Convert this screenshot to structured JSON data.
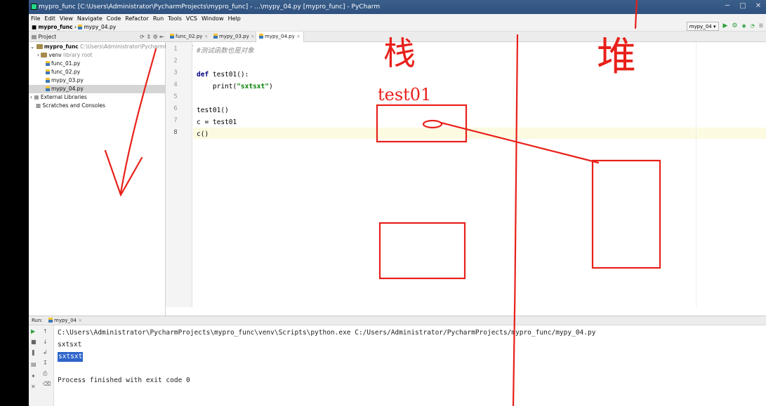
{
  "window": {
    "title": "mypro_func [C:\\Users\\Administrator\\PycharmProjects\\mypro_func] - ...\\mypy_04.py [mypro_func] - PyCharm",
    "controls": [
      "─",
      "□",
      "✕"
    ]
  },
  "menu": [
    "File",
    "Edit",
    "View",
    "Navigate",
    "Code",
    "Refactor",
    "Run",
    "Tools",
    "VCS",
    "Window",
    "Help"
  ],
  "breadcrumb": {
    "project": "mypro_func",
    "file": "mypy_04.py"
  },
  "run_config": {
    "name": "mypy_04"
  },
  "project_panel": {
    "header": "Project",
    "tree": [
      {
        "label": "mypro_func",
        "suffix": "C:\\Users\\Administrator\\PycharmProjects\\mypro_func",
        "type": "folder"
      },
      {
        "label": "venv",
        "suffix": "library root",
        "type": "folder"
      },
      {
        "label": "func_01.py",
        "type": "py"
      },
      {
        "label": "func_02.py",
        "type": "py"
      },
      {
        "label": "mypy_03.py",
        "type": "py"
      },
      {
        "label": "mypy_04.py",
        "type": "py"
      },
      {
        "label": "External Libraries",
        "type": "lib"
      },
      {
        "label": "Scratches and Consoles",
        "type": "scratch"
      }
    ]
  },
  "editor": {
    "tabs": [
      "func_02.py",
      "mypy_03.py",
      "mypy_04.py"
    ],
    "active_tab": 2,
    "line_numbers": [
      "1",
      "2",
      "3",
      "4",
      "5",
      "6",
      "7",
      "8"
    ],
    "code": {
      "l1": "#测试函数也是对象",
      "l3_kw": "def",
      "l3_rest": " test01():",
      "l4_pre": "    print(",
      "l4_str": "\"sxtsxt\"",
      "l4_post": ")",
      "l6": "test01()",
      "l7": "c = test01",
      "l8": "c()"
    }
  },
  "run_panel": {
    "header": "Run:",
    "tab": "mypy_04",
    "output": [
      "C:\\Users\\Administrator\\PycharmProjects\\mypro_func\\venv\\Scripts\\python.exe C:/Users/Administrator/PycharmProjects/mypro_func/mypy_04.py",
      "sxtsxt",
      "sxtsxt",
      "",
      "Process finished with exit code 0"
    ]
  },
  "annotations": {
    "color": "#e8201a",
    "stack_label": "栈",
    "heap_label": "堆",
    "box_label": "test01"
  }
}
